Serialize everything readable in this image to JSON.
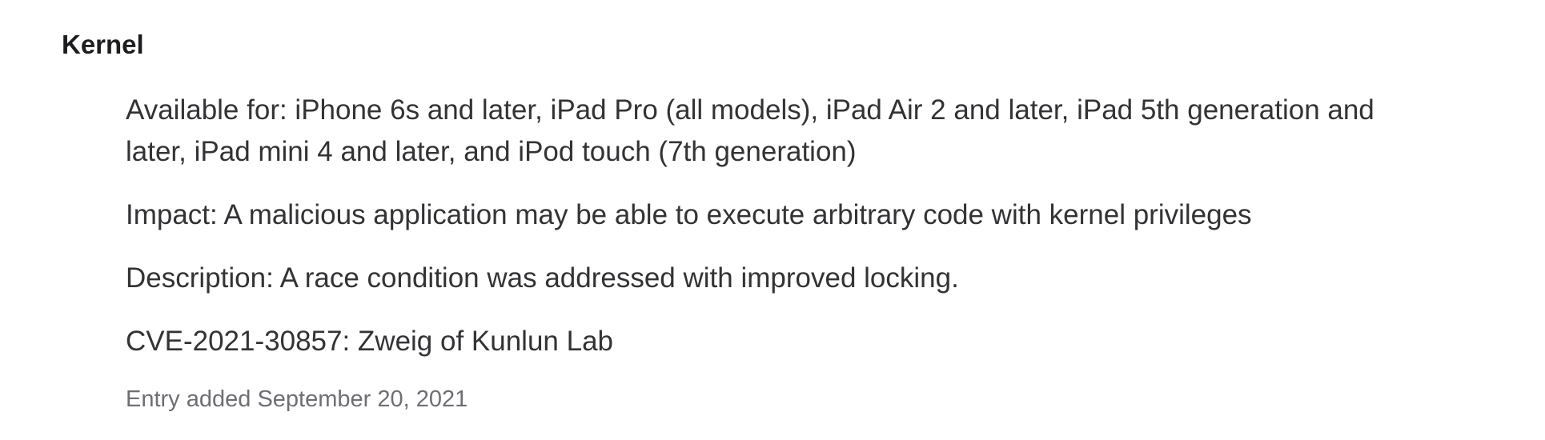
{
  "section": {
    "title": "Kernel"
  },
  "entry": {
    "available_for": "Available for: iPhone 6s and later, iPad Pro (all models), iPad Air 2 and later, iPad 5th generation and later, iPad mini 4 and later, and iPod touch (7th generation)",
    "impact": "Impact: A malicious application may be able to execute arbitrary code with kernel privileges",
    "description": "Description: A race condition was addressed with improved locking.",
    "cve": "CVE-2021-30857: Zweig of Kunlun Lab",
    "entry_added": "Entry added September 20, 2021"
  }
}
